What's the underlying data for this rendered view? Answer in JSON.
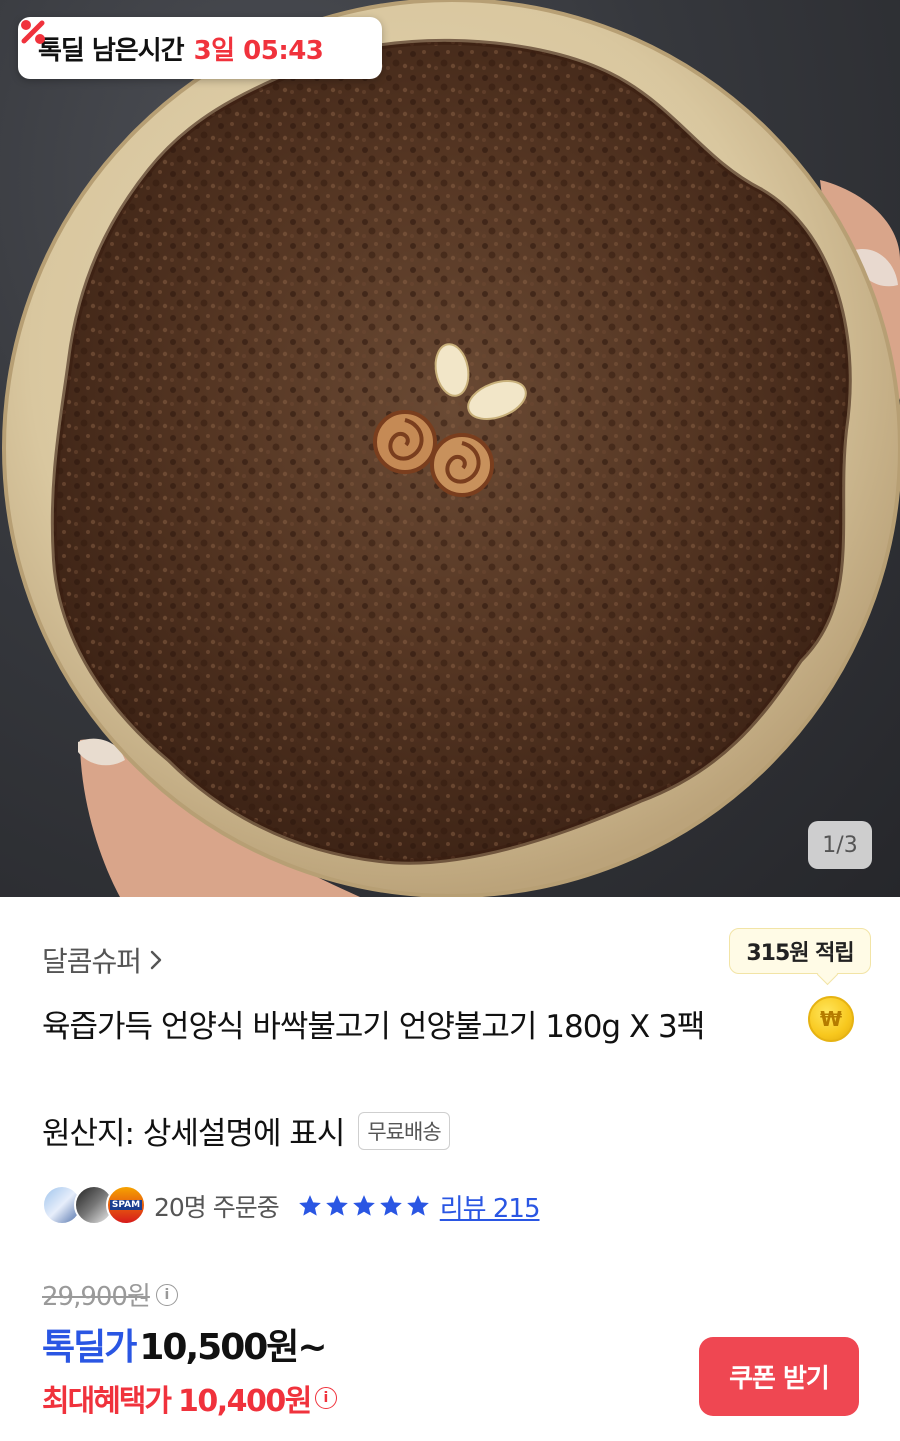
{
  "deal_timer": {
    "icon": "percent-tag-icon",
    "label": "톡딜 남은시간",
    "time": "3일 05:43"
  },
  "gallery": {
    "page_indicator": "1/3",
    "current_page": 1,
    "total_pages": 3
  },
  "seller": {
    "name": "달콤슈퍼",
    "chevron_icon": "chevron-right-icon"
  },
  "reward": {
    "tooltip": "315원 적립",
    "coin_icon": "won-coin-icon",
    "coin_symbol": "₩"
  },
  "product": {
    "title": "육즙가득 언양식 바싹불고기 언양불고기 180g X 3팩",
    "origin": "원산지: 상세설명에 표시",
    "shipping_badge": "무료배송"
  },
  "social": {
    "orders": "20명 주문중",
    "avatar_badge": "SPAM",
    "rating_stars": 5,
    "review_link": "리뷰 215"
  },
  "pricing": {
    "original": "29,900원",
    "deal_label": "톡딜가",
    "deal_price": "10,500원~",
    "max_label": "최대혜택가",
    "max_price": "10,400원",
    "info_icon": "info-icon"
  },
  "actions": {
    "coupon_button": "쿠폰 받기"
  },
  "colors": {
    "accent_red": "#f0323c",
    "accent_blue": "#2a56e3",
    "coupon_button_bg": "#ef4752",
    "reward_tooltip_bg": "#fffbe6"
  }
}
